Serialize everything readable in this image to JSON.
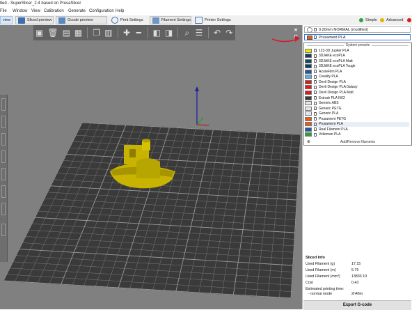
{
  "window": {
    "title": "tled - SuperSlicer_2.4  based on PrusaSlicer"
  },
  "menu": [
    "File",
    "Window",
    "View",
    "Calibration",
    "Generate",
    "Configuration",
    "Help"
  ],
  "tabs": [
    {
      "label": "view",
      "active": true
    },
    {
      "label": "Sliced preview",
      "active": false
    },
    {
      "label": "Gcode preview",
      "active": false
    },
    {
      "label": "Print Settings",
      "active": false
    },
    {
      "label": "Filament Settings",
      "active": false
    },
    {
      "label": "Printer Settings",
      "active": false
    }
  ],
  "modes": [
    {
      "label": "Simple",
      "color": "#2ea043"
    },
    {
      "label": "Advanced",
      "color": "#e8b400"
    }
  ],
  "colors": {
    "viewport_bg": "#808080",
    "bed": "#3c3c3c",
    "model": "#c8b400",
    "accent": "#ed6b21"
  },
  "sidebar": {
    "print_profile": "0.20mm NORMAL (modified)",
    "filament_selected": "Prusament PLA",
    "dropdown_header": "System presets",
    "dropdown_footer": "Add/Remove filaments",
    "filaments": [
      {
        "name": "123-3D Jupiter PLA",
        "color": "#f2e600"
      },
      {
        "name": "3DJAKE ecoPLA",
        "color": "#0e3f5c"
      },
      {
        "name": "3DJAKE ecoPLA Matt",
        "color": "#0f4a62"
      },
      {
        "name": "3DJAKE ecoPLA Tough",
        "color": "#0e3e58"
      },
      {
        "name": "AzureFilm PLA",
        "color": "#2c4fa0"
      },
      {
        "name": "Creality PLA",
        "color": "#5ab0e0"
      },
      {
        "name": "Devil Design PLA",
        "color": "#d81c1c"
      },
      {
        "name": "Devil Design PLA Galaxy",
        "color": "#d81c1c"
      },
      {
        "name": "Devil Design PLA Matt",
        "color": "#d81c1c"
      },
      {
        "name": "Extrudr PLA NX2",
        "color": "#3a3a3a"
      },
      {
        "name": "Generic ABS",
        "color": "#e6e6e6"
      },
      {
        "name": "Generic PETG",
        "color": "#e6e6e6"
      },
      {
        "name": "Generic PLA",
        "color": "#e6e6e6"
      },
      {
        "name": "Prusament PETG",
        "color": "#e8591a"
      },
      {
        "name": "Prusament PLA",
        "color": "#e8591a"
      },
      {
        "name": "Real Filament PLA",
        "color": "#1e5aa8"
      },
      {
        "name": "Velleman PLA",
        "color": "#2e9d3a"
      }
    ]
  },
  "sliced_info": {
    "title": "Sliced Info",
    "rows": [
      {
        "label": "Used Filament (g)",
        "value": "17.15"
      },
      {
        "label": "Used Filament (m)",
        "value": "5.75"
      },
      {
        "label": "Used Filament (mm³)",
        "value": "13833.19"
      },
      {
        "label": "Cost",
        "value": "0.43"
      }
    ],
    "time_label": "Estimated printing time:",
    "mode_label": "- normal mode",
    "mode_value": "2h46m"
  },
  "export_label": "Export G-code"
}
